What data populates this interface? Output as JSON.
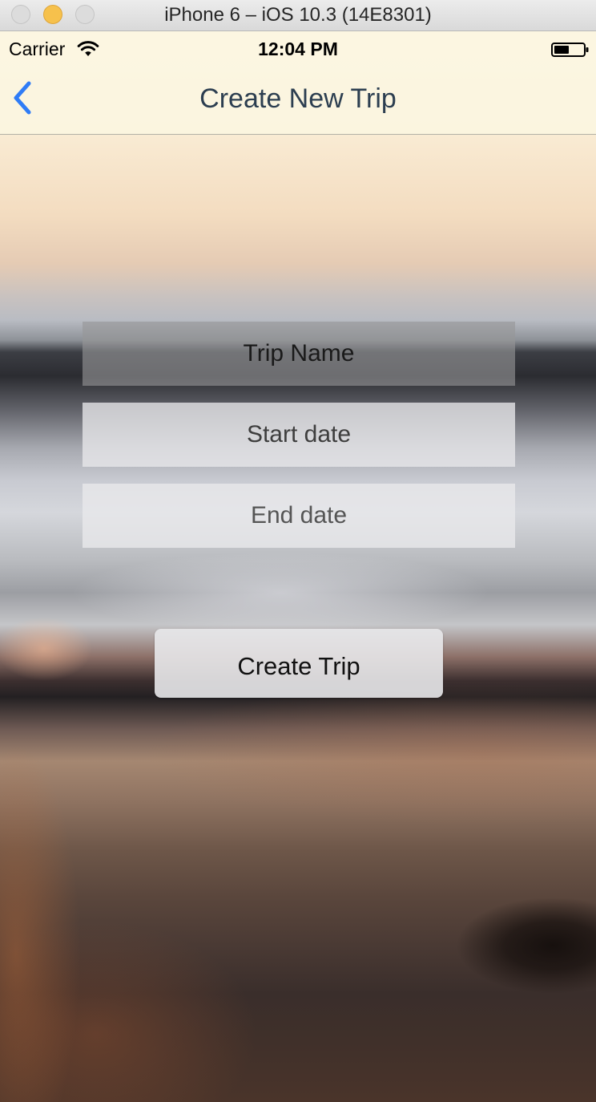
{
  "window": {
    "title": "iPhone 6 – iOS 10.3 (14E8301)"
  },
  "status_bar": {
    "carrier": "Carrier",
    "time": "12:04 PM",
    "wifi_icon": "wifi-icon",
    "battery_icon": "battery-icon"
  },
  "nav": {
    "back_icon": "chevron-left-icon",
    "title": "Create New Trip",
    "accent_color": "#2f7cf6"
  },
  "form": {
    "trip_name": {
      "placeholder": "Trip Name",
      "value": ""
    },
    "start_date": {
      "placeholder": "Start date",
      "value": ""
    },
    "end_date": {
      "placeholder": "End date",
      "value": ""
    },
    "submit_label": "Create Trip"
  }
}
